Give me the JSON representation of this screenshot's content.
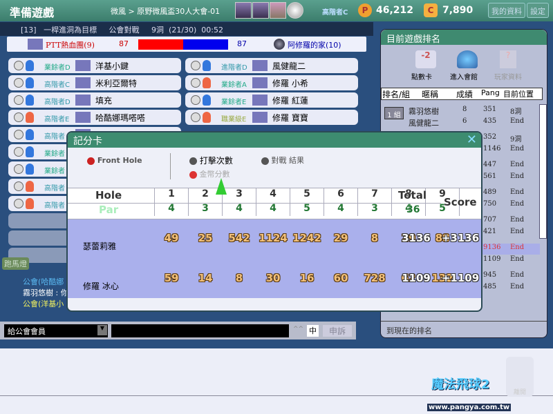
{
  "topbar": {
    "title": "準備遊戲",
    "breadcrumb": "微風 > 原野微風盃30人大會-01",
    "rank": "高階者C",
    "pang": "46,212",
    "cookie": "7,890",
    "my_info": "我的資料",
    "settings": "設定",
    "pang_icon": "P",
    "cookie_icon": "C"
  },
  "info": "[13]   一桿進洞為目標     公會對戰     9洞  (21/30)  00:52",
  "team_bar": {
    "left_team": "PTT熱血團(9)",
    "left_score": "87",
    "right_score": "87",
    "right_team": "阿修羅的家(10)",
    "left_fraction": 0.5,
    "colors": {
      "left": "#ff0000",
      "right": "#0000ee"
    }
  },
  "players_left": [
    {
      "rank": "業餘者D",
      "name": "洋基小鍵",
      "gender": "m"
    },
    {
      "rank": "高階者C",
      "name": "米利亞爾特",
      "gender": "m"
    },
    {
      "rank": "高階者D",
      "name": "填充",
      "gender": "m"
    },
    {
      "rank": "高階者E",
      "name": "哈酷娜瑪嗒嗒",
      "gender": "f"
    },
    {
      "rank": "高階者",
      "name": "",
      "gender": "m"
    },
    {
      "rank": "業餘者",
      "name": "",
      "gender": "m"
    },
    {
      "rank": "業餘者",
      "name": "",
      "gender": "m"
    },
    {
      "rank": "高階者",
      "name": "",
      "gender": "f"
    },
    {
      "rank": "高階者",
      "name": "",
      "gender": "f"
    }
  ],
  "players_right": [
    {
      "rank": "進階者D",
      "name": "風健龍二",
      "gender": "m"
    },
    {
      "rank": "業餘者A",
      "name": "修羅 小希",
      "gender": "f"
    },
    {
      "rank": "業餘者E",
      "name": "修羅 紅蓮",
      "gender": "m"
    },
    {
      "rank": "職業級E",
      "name": "修羅 寶寶",
      "gender": "f"
    }
  ],
  "marquee": "跑馬燈",
  "chat": [
    {
      "text": "公會(哈酷娜",
      "color": "#5ab8f0"
    },
    {
      "text": "霧羽悠樹 :  你們都打玩了嗎==",
      "color": "#ffffff"
    },
    {
      "text": "公會(洋基小",
      "color": "#f0f060"
    }
  ],
  "chat_bar": {
    "channel": "給公會會員",
    "input": "",
    "ime": "中",
    "report": "申訴",
    "font": "^^"
  },
  "ranking": {
    "title": "目前遊戲排名",
    "tools": [
      "點數卡",
      "進入會館",
      "玩家資料"
    ],
    "headers": [
      "排名/組",
      "暱稱",
      "成績",
      "Pang",
      "目前位置"
    ],
    "group_label": "1 組",
    "rows": [
      {
        "name": "霧羽悠樹",
        "score": "8",
        "pang": "351",
        "pos": "8洞"
      },
      {
        "name": "風健龍二",
        "score": "6",
        "pang": "435",
        "pos": "End"
      },
      {
        "name": "",
        "score": "",
        "pang": "352",
        "pos": "9洞"
      },
      {
        "name": "",
        "score": "",
        "pang": "1146",
        "pos": "End"
      },
      {
        "name": "",
        "score": "",
        "pang": "447",
        "pos": "End"
      },
      {
        "name": "",
        "score": "",
        "pang": "561",
        "pos": "End"
      },
      {
        "name": "",
        "score": "",
        "pang": "489",
        "pos": "End"
      },
      {
        "name": "",
        "score": "",
        "pang": "750",
        "pos": "End"
      },
      {
        "name": "",
        "score": "",
        "pang": "707",
        "pos": "End"
      },
      {
        "name": "",
        "score": "",
        "pang": "421",
        "pos": "End"
      },
      {
        "name": "",
        "score": "",
        "pang": "9136",
        "pos": "End",
        "highlight": true
      },
      {
        "name": "",
        "score": "",
        "pang": "1109",
        "pos": "End"
      },
      {
        "name": "",
        "score": "",
        "pang": "945",
        "pos": "End"
      },
      {
        "name": "",
        "score": "",
        "pang": "485",
        "pos": "End"
      }
    ],
    "footer": "到現在的排名"
  },
  "scorecard": {
    "title": "記分卡",
    "front_hole": "Front Hole",
    "opt_strokes": "打擊次數",
    "opt_coins": "金幣分數",
    "opt_result": "對戰 結果",
    "hole_label": "Hole",
    "par_label": "Par",
    "total_label": "Total",
    "score_label": "Score",
    "holes": [
      "1",
      "2",
      "3",
      "4",
      "5",
      "6",
      "7",
      "8",
      "9"
    ],
    "par": [
      "4",
      "3",
      "4",
      "4",
      "5",
      "4",
      "3",
      "4",
      "5"
    ],
    "par_total": "36",
    "players": [
      {
        "name": "瑟蕾莉雅",
        "scores": [
          "49",
          "25",
          "542",
          "1124",
          "1242",
          "29",
          "8",
          "29",
          "88"
        ],
        "total": "3136",
        "score": "+3136"
      },
      {
        "name": "修羅 冰心",
        "scores": [
          "59",
          "14",
          "8",
          "30",
          "16",
          "60",
          "728",
          "62",
          "132"
        ],
        "total": "1109",
        "score": "+1109"
      }
    ]
  },
  "logo": {
    "title": "魔法飛球2",
    "url": "www.pangya.com.tw",
    "corner_btn": "離開"
  }
}
